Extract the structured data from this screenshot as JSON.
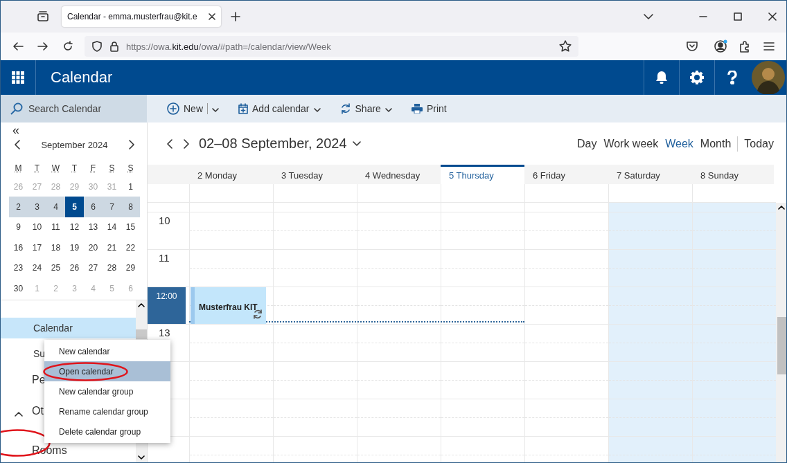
{
  "browser": {
    "tab_title": "Calendar - emma.musterfrau@kit.e",
    "url_prefix": "https://owa.",
    "url_domain": "kit.edu",
    "url_path": "/owa/#path=/calendar/view/Week"
  },
  "app": {
    "title": "Calendar"
  },
  "search": {
    "placeholder": "Search Calendar"
  },
  "toolbar": [
    {
      "label": "New",
      "kind": "split"
    },
    {
      "label": "Add calendar",
      "kind": "dropdown"
    },
    {
      "label": "Share",
      "kind": "dropdown"
    },
    {
      "label": "Print",
      "kind": "plain"
    }
  ],
  "mini_calendar": {
    "collapse": "«",
    "month": "September 2024",
    "weekdays": [
      "M",
      "T",
      "W",
      "T",
      "F",
      "S",
      "S"
    ],
    "weeks": [
      {
        "in_view": false,
        "days": [
          {
            "day": "26",
            "other_month": true,
            "selected": false
          },
          {
            "day": "27",
            "other_month": true,
            "selected": false
          },
          {
            "day": "28",
            "other_month": true,
            "selected": false
          },
          {
            "day": "29",
            "other_month": true,
            "selected": false
          },
          {
            "day": "30",
            "other_month": true,
            "selected": false
          },
          {
            "day": "31",
            "other_month": true,
            "selected": false
          },
          {
            "day": "1",
            "other_month": false,
            "selected": false
          }
        ]
      },
      {
        "in_view": true,
        "days": [
          {
            "day": "2",
            "other_month": false,
            "selected": false
          },
          {
            "day": "3",
            "other_month": false,
            "selected": false
          },
          {
            "day": "4",
            "other_month": false,
            "selected": false
          },
          {
            "day": "5",
            "other_month": false,
            "selected": true
          },
          {
            "day": "6",
            "other_month": false,
            "selected": false
          },
          {
            "day": "7",
            "other_month": false,
            "selected": false
          },
          {
            "day": "8",
            "other_month": false,
            "selected": false
          }
        ]
      },
      {
        "in_view": false,
        "days": [
          {
            "day": "9",
            "other_month": false,
            "selected": false
          },
          {
            "day": "10",
            "other_month": false,
            "selected": false
          },
          {
            "day": "11",
            "other_month": false,
            "selected": false
          },
          {
            "day": "12",
            "other_month": false,
            "selected": false
          },
          {
            "day": "13",
            "other_month": false,
            "selected": false
          },
          {
            "day": "14",
            "other_month": false,
            "selected": false
          },
          {
            "day": "15",
            "other_month": false,
            "selected": false
          }
        ]
      },
      {
        "in_view": false,
        "days": [
          {
            "day": "16",
            "other_month": false,
            "selected": false
          },
          {
            "day": "17",
            "other_month": false,
            "selected": false
          },
          {
            "day": "18",
            "other_month": false,
            "selected": false
          },
          {
            "day": "19",
            "other_month": false,
            "selected": false
          },
          {
            "day": "20",
            "other_month": false,
            "selected": false
          },
          {
            "day": "21",
            "other_month": false,
            "selected": false
          },
          {
            "day": "22",
            "other_month": false,
            "selected": false
          }
        ]
      },
      {
        "in_view": false,
        "days": [
          {
            "day": "23",
            "other_month": false,
            "selected": false
          },
          {
            "day": "24",
            "other_month": false,
            "selected": false
          },
          {
            "day": "25",
            "other_month": false,
            "selected": false
          },
          {
            "day": "26",
            "other_month": false,
            "selected": false
          },
          {
            "day": "27",
            "other_month": false,
            "selected": false
          },
          {
            "day": "28",
            "other_month": false,
            "selected": false
          },
          {
            "day": "29",
            "other_month": false,
            "selected": false
          }
        ]
      },
      {
        "in_view": false,
        "days": [
          {
            "day": "30",
            "other_month": false,
            "selected": false
          },
          {
            "day": "1",
            "other_month": true,
            "selected": false
          },
          {
            "day": "2",
            "other_month": true,
            "selected": false
          },
          {
            "day": "3",
            "other_month": true,
            "selected": false
          },
          {
            "day": "4",
            "other_month": true,
            "selected": false
          },
          {
            "day": "5",
            "other_month": true,
            "selected": false
          },
          {
            "day": "6",
            "other_month": true,
            "selected": false
          }
        ]
      }
    ]
  },
  "folders": [
    {
      "label": "Calendar",
      "kind": "calendar",
      "selected": true,
      "circled": false
    },
    {
      "label": "Su",
      "kind": "calendar",
      "selected": false,
      "circled": false
    },
    {
      "label": "Pe",
      "kind": "group",
      "selected": false,
      "circled": false
    },
    {
      "label": "Ot",
      "kind": "group",
      "selected": false,
      "circled": false,
      "expanded": true
    },
    {
      "label": "Rooms",
      "kind": "group",
      "selected": false,
      "circled": true
    }
  ],
  "context_menu": [
    {
      "label": "New calendar",
      "selected": false,
      "circled": false
    },
    {
      "label": "Open calendar",
      "selected": true,
      "circled": true
    },
    {
      "label": "New calendar group",
      "selected": false,
      "circled": false
    },
    {
      "label": "Rename calendar group",
      "selected": false,
      "circled": false
    },
    {
      "label": "Delete calendar group",
      "selected": false,
      "circled": false
    }
  ],
  "week_view": {
    "range": "02–08 September, 2024",
    "views": [
      {
        "label": "Day",
        "selected": false
      },
      {
        "label": "Work week",
        "selected": false
      },
      {
        "label": "Week",
        "selected": true
      },
      {
        "label": "Month",
        "selected": false
      }
    ],
    "today_button": "Today",
    "days": [
      {
        "label": "2 Monday",
        "today": false,
        "weekend": false,
        "events": [
          {
            "title": "Musterfrau KIT",
            "recurring": true
          }
        ]
      },
      {
        "label": "3 Tuesday",
        "today": false,
        "weekend": false
      },
      {
        "label": "4 Wednesday",
        "today": false,
        "weekend": false
      },
      {
        "label": "5 Thursday",
        "today": true,
        "weekend": false
      },
      {
        "label": "6 Friday",
        "today": false,
        "weekend": false
      },
      {
        "label": "7 Saturday",
        "today": false,
        "weekend": true
      },
      {
        "label": "8 Sunday",
        "today": false,
        "weekend": true
      }
    ],
    "hours": [
      {
        "label": "10",
        "current": false
      },
      {
        "label": "11",
        "current": false
      },
      {
        "label": "12:00",
        "current": true
      },
      {
        "label": "13",
        "current": false
      }
    ]
  }
}
